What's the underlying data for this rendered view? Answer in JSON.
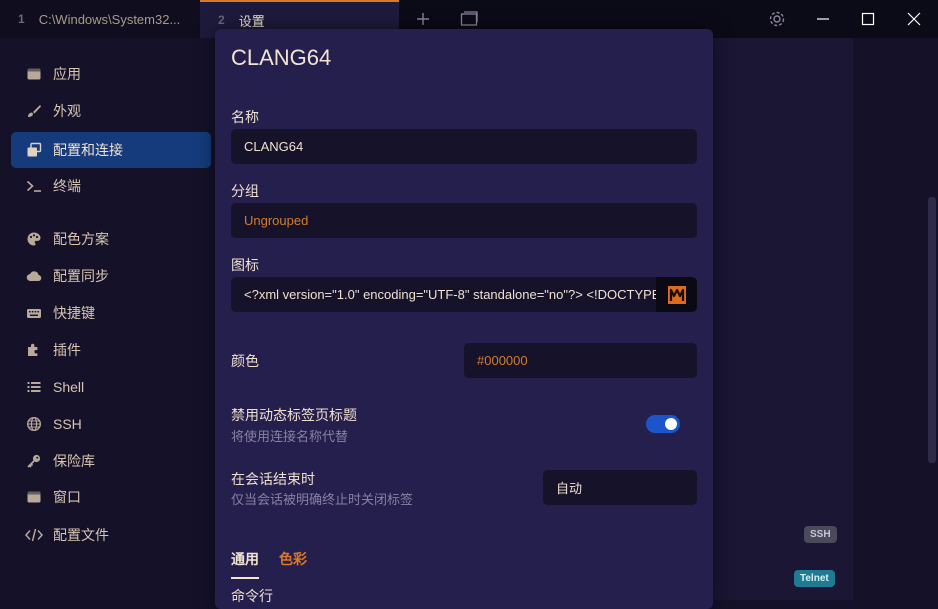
{
  "titlebar": {
    "tabs": [
      {
        "num": "1",
        "title": "C:\\Windows\\System32..."
      },
      {
        "num": "2",
        "title": "设置"
      }
    ],
    "icons": [
      "plus-icon",
      "window-icon",
      "gear-icon",
      "minimize-icon",
      "maximize-icon",
      "close-icon"
    ]
  },
  "sidebar": {
    "items": [
      {
        "label": "应用",
        "icon": "app-icon"
      },
      {
        "label": "外观",
        "icon": "brush-icon"
      },
      {
        "label": "配置和连接",
        "icon": "profiles-icon",
        "active": true
      },
      {
        "label": "终端",
        "icon": "terminal-icon"
      },
      {
        "label": "配色方案",
        "icon": "palette-icon"
      },
      {
        "label": "配置同步",
        "icon": "cloud-icon"
      },
      {
        "label": "快捷键",
        "icon": "keyboard-icon"
      },
      {
        "label": "插件",
        "icon": "puzzle-icon"
      },
      {
        "label": "Shell",
        "icon": "list-icon"
      },
      {
        "label": "SSH",
        "icon": "globe-icon"
      },
      {
        "label": "保险库",
        "icon": "key-icon"
      },
      {
        "label": "窗口",
        "icon": "window-icon"
      },
      {
        "label": "配置文件",
        "icon": "code-icon"
      }
    ]
  },
  "background": {
    "badges": [
      "SSH",
      "Telnet"
    ]
  },
  "modal": {
    "title": "CLANG64",
    "name_label": "名称",
    "name_value": "CLANG64",
    "group_label": "分组",
    "group_value": "Ungrouped",
    "icon_label": "图标",
    "icon_value": "<?xml version=\"1.0\" encoding=\"UTF-8\" standalone=\"no\"?> <!DOCTYPE",
    "color_label": "颜色",
    "color_value": "#000000",
    "dynamic_title_label": "禁用动态标签页标题",
    "dynamic_title_desc": "将使用连接名称代替",
    "dynamic_title_enabled": true,
    "session_end_label": "在会话结束时",
    "session_end_desc": "仅当会话被明确终止时关闭标签",
    "session_end_value": "自动",
    "tabs": [
      "通用",
      "色彩"
    ],
    "next_section_label": "命令行"
  },
  "colors": {
    "accent_orange": "#d9792b",
    "active_nav": "#153b7c",
    "toggle_on": "#1c55c9",
    "badge_ssh": "#4a4a5c",
    "badge_telnet": "#1f7a92"
  }
}
